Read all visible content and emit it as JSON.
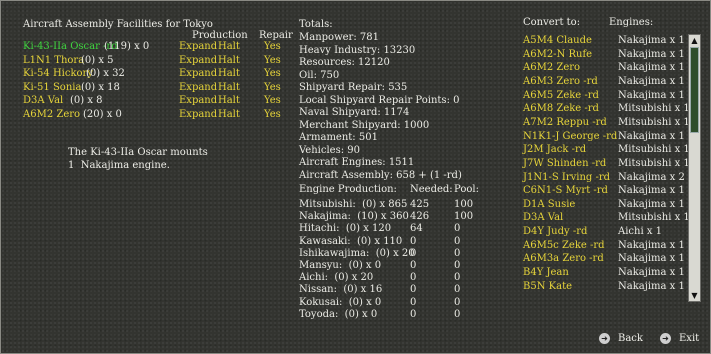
{
  "left": {
    "title": "Aircraft Assembly Facilities for Tokyo",
    "headers": {
      "production": "Production",
      "repair": "Repair"
    },
    "rows": [
      {
        "name": "Ki-43-IIa Oscar -rd",
        "qty": "(119) x 0",
        "expand": "Expand",
        "halt": "Halt",
        "repair": "Yes",
        "selected": true
      },
      {
        "name": "L1N1 Thora",
        "qty": "(0) x 5",
        "expand": "Expand",
        "halt": "Halt",
        "repair": "Yes"
      },
      {
        "name": "Ki-54 Hickory",
        "qty": "(0) x 32",
        "expand": "Expand",
        "halt": "Halt",
        "repair": "Yes"
      },
      {
        "name": "Ki-51 Sonia",
        "qty": "(0) x 18",
        "expand": "Expand",
        "halt": "Halt",
        "repair": "Yes"
      },
      {
        "name": "D3A Val",
        "qty": "(0) x 8",
        "expand": "Expand",
        "halt": "Halt",
        "repair": "Yes"
      },
      {
        "name": "A6M2 Zero",
        "qty": "(20) x 0",
        "expand": "Expand",
        "halt": "Halt",
        "repair": "Yes"
      }
    ],
    "info_line1": "The Ki-43-IIa Oscar mounts",
    "info_line2": "1  Nakajima engine."
  },
  "totals": {
    "title": "Totals:",
    "lines": [
      "Manpower: 781",
      "Heavy Industry: 13230",
      "Resources: 12120",
      "Oil: 750",
      "Shipyard Repair: 535",
      "Local Shipyard Repair Points: 0",
      "Naval Shipyard: 1174",
      "Merchant Shipyard: 1000",
      "Armament: 501",
      "Vehicles: 90",
      "Aircraft Engines: 1511",
      "Aircraft Assembly: 658 + (1 -rd)"
    ]
  },
  "engines": {
    "headers": {
      "name": "Engine Production:",
      "needed": "Needed:",
      "pool": "Pool:"
    },
    "rows": [
      {
        "name": "Mitsubishi:  (0) x 865",
        "needed": "425",
        "pool": "100"
      },
      {
        "name": "Nakajima:  (10) x 360",
        "needed": "426",
        "pool": "100"
      },
      {
        "name": "Hitachi:  (0) x 120",
        "needed": "64",
        "pool": "0"
      },
      {
        "name": "Kawasaki:  (0) x 110",
        "needed": "0",
        "pool": "0"
      },
      {
        "name": "Ishikawajima:  (0) x 20",
        "needed": "0",
        "pool": "0"
      },
      {
        "name": "Mansyu:  (0) x 0",
        "needed": "0",
        "pool": "0"
      },
      {
        "name": "Aichi:  (0) x 20",
        "needed": "0",
        "pool": "0"
      },
      {
        "name": "Nissan:  (0) x 16",
        "needed": "0",
        "pool": "0"
      },
      {
        "name": "Kokusai:  (0) x 0",
        "needed": "0",
        "pool": "0"
      },
      {
        "name": "Toyoda:  (0) x 0",
        "needed": "0",
        "pool": "0"
      }
    ]
  },
  "convert": {
    "headers": {
      "to": "Convert to:",
      "engines": "Engines:"
    },
    "rows": [
      {
        "name": "A5M4 Claude",
        "engine": "Nakajima x 1"
      },
      {
        "name": "A6M2-N Rufe",
        "engine": "Nakajima x 1"
      },
      {
        "name": "A6M2 Zero",
        "engine": "Nakajima x 1"
      },
      {
        "name": "A6M3 Zero -rd",
        "engine": "Nakajima x 1"
      },
      {
        "name": "A6M5 Zeke -rd",
        "engine": "Nakajima x 1"
      },
      {
        "name": "A6M8 Zeke -rd",
        "engine": "Mitsubishi x 1"
      },
      {
        "name": "A7M2 Reppu -rd",
        "engine": "Mitsubishi x 1"
      },
      {
        "name": "N1K1-J George -rd",
        "engine": "Nakajima x 1"
      },
      {
        "name": "J2M Jack -rd",
        "engine": "Mitsubishi x 1"
      },
      {
        "name": "J7W Shinden -rd",
        "engine": "Mitsubishi x 1"
      },
      {
        "name": "J1N1-S Irving -rd",
        "engine": "Nakajima x 2"
      },
      {
        "name": "C6N1-S Myrt -rd",
        "engine": "Nakajima x 1"
      },
      {
        "name": "D1A Susie",
        "engine": "Nakajima x 1"
      },
      {
        "name": "D3A Val",
        "engine": "Mitsubishi x 1"
      },
      {
        "name": "D4Y Judy -rd",
        "engine": "Aichi x 1"
      },
      {
        "name": "A6M5c Zeke -rd",
        "engine": "Nakajima x 1"
      },
      {
        "name": "A6M3a Zero -rd",
        "engine": "Nakajima x 1"
      },
      {
        "name": "B4Y Jean",
        "engine": "Nakajima x 1"
      },
      {
        "name": "B5N Kate",
        "engine": "Nakajima x 1"
      }
    ]
  },
  "nav": {
    "back": "Back",
    "exit": "Exit"
  },
  "icons": {
    "scroll_up": "arrow-up-icon",
    "scroll_down": "arrow-down-icon",
    "back": "back-arrow-icon",
    "exit": "exit-arrow-icon"
  },
  "colors": {
    "link": "#e6d43a",
    "selected": "#3fd53f",
    "text": "#e8e8e2",
    "background": "#333430"
  }
}
